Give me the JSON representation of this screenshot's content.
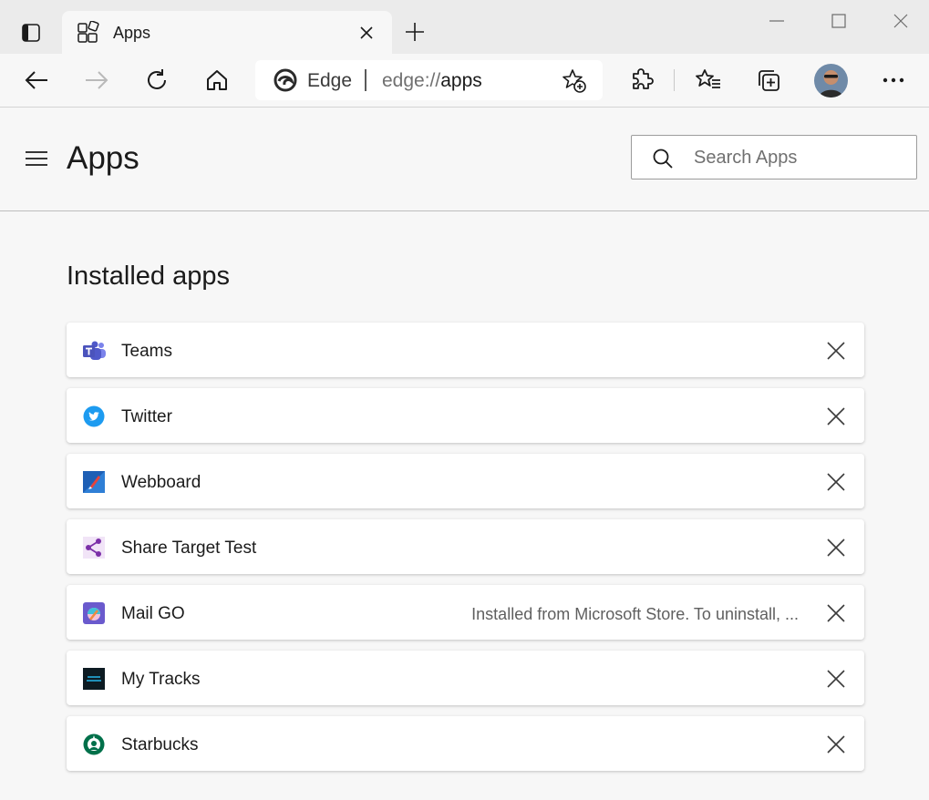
{
  "browser": {
    "tab": {
      "title": "Apps"
    },
    "window_controls": [
      "minimize",
      "maximize",
      "close"
    ],
    "address_bar": {
      "brand": "Edge",
      "url_protocol": "edge://",
      "url_path": "apps"
    }
  },
  "page": {
    "title": "Apps",
    "search": {
      "placeholder": "Search Apps",
      "value": ""
    },
    "section_title": "Installed apps",
    "apps": [
      {
        "name": "Teams",
        "icon": "teams-icon",
        "note": ""
      },
      {
        "name": "Twitter",
        "icon": "twitter-icon",
        "note": ""
      },
      {
        "name": "Webboard",
        "icon": "webboard-icon",
        "note": ""
      },
      {
        "name": "Share Target Test",
        "icon": "share-icon",
        "note": ""
      },
      {
        "name": "Mail GO",
        "icon": "mail-go-icon",
        "note": "Installed from Microsoft Store. To uninstall, ..."
      },
      {
        "name": "My Tracks",
        "icon": "my-tracks-icon",
        "note": ""
      },
      {
        "name": "Starbucks",
        "icon": "starbucks-icon",
        "note": ""
      }
    ]
  },
  "colors": {
    "titlebar_bg": "#ebebeb",
    "page_bg": "#f7f7f7",
    "card_bg": "#ffffff",
    "text": "#1b1b1b",
    "muted_text": "#5f5f5f"
  }
}
